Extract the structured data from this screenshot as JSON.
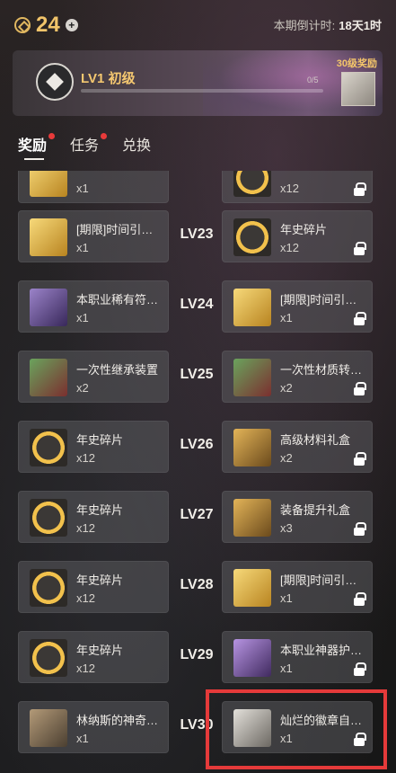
{
  "topbar": {
    "coin_count": "24",
    "countdown_label": "本期倒计时:",
    "countdown_value": "18天1时"
  },
  "banner": {
    "level_title": "LV1 初级",
    "progress_text": "0/5",
    "progress_fraction": 0,
    "reward_badge": "30级奖励"
  },
  "tabs": [
    {
      "label": "奖励",
      "active": true,
      "has_dot": true
    },
    {
      "label": "任务",
      "active": false,
      "has_dot": true
    },
    {
      "label": "兑换",
      "active": false,
      "has_dot": false
    }
  ],
  "rows": [
    {
      "level": "",
      "left": {
        "name": "",
        "qty": "x1",
        "icon": "gold"
      },
      "right": {
        "name": "",
        "qty": "x12",
        "icon": "coin",
        "locked": true
      }
    },
    {
      "level": "LV23",
      "left": {
        "name": "[期限]时间引…",
        "qty": "x1",
        "icon": "gold"
      },
      "right": {
        "name": "年史碎片",
        "qty": "x12",
        "icon": "coin",
        "locked": true
      }
    },
    {
      "level": "LV24",
      "left": {
        "name": "本职业稀有符…",
        "qty": "x1",
        "icon": "purple"
      },
      "right": {
        "name": "[期限]时间引…",
        "qty": "x1",
        "icon": "gold",
        "locked": true
      }
    },
    {
      "level": "LV25",
      "left": {
        "name": "一次性继承装置",
        "qty": "x2",
        "icon": "green"
      },
      "right": {
        "name": "一次性材质转…",
        "qty": "x2",
        "icon": "green",
        "locked": true
      }
    },
    {
      "level": "LV26",
      "left": {
        "name": "年史碎片",
        "qty": "x12",
        "icon": "coin"
      },
      "right": {
        "name": "高级材料礼盒",
        "qty": "x2",
        "icon": "chest",
        "locked": true
      }
    },
    {
      "level": "LV27",
      "left": {
        "name": "年史碎片",
        "qty": "x12",
        "icon": "coin"
      },
      "right": {
        "name": "装备提升礼盒",
        "qty": "x3",
        "icon": "chest",
        "locked": true
      }
    },
    {
      "level": "LV28",
      "left": {
        "name": "年史碎片",
        "qty": "x12",
        "icon": "coin"
      },
      "right": {
        "name": "[期限]时间引…",
        "qty": "x1",
        "icon": "gold",
        "locked": true
      }
    },
    {
      "level": "LV29",
      "left": {
        "name": "年史碎片",
        "qty": "x12",
        "icon": "coin"
      },
      "right": {
        "name": "本职业神器护…",
        "qty": "x1",
        "icon": "violet",
        "locked": true
      }
    },
    {
      "level": "LV30",
      "left": {
        "name": "林纳斯的神奇…",
        "qty": "x1",
        "icon": "brown"
      },
      "right": {
        "name": "灿烂的徽章自…",
        "qty": "x1",
        "icon": "silver",
        "locked": true
      }
    }
  ]
}
